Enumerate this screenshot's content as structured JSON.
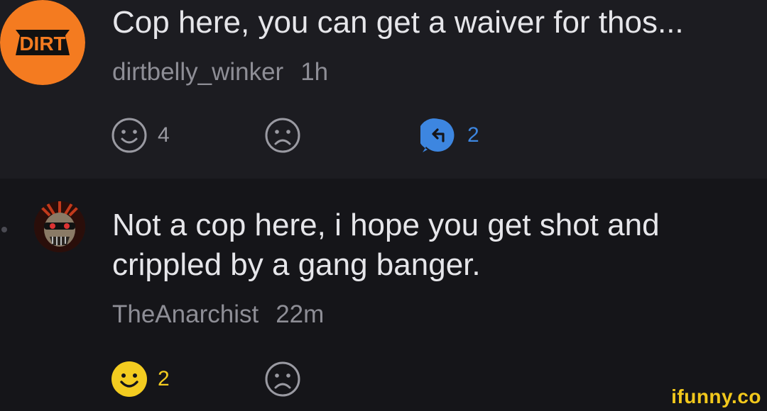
{
  "comments": [
    {
      "avatar": "dirt-logo-avatar",
      "avatar_text": "DIRT",
      "text": "Cop here, you can get a waiver for thos...",
      "username": "dirtbelly_winker",
      "time": "1h",
      "smile_count": "4",
      "reply_count": "2"
    },
    {
      "avatar": "skull-avatar",
      "text": "Not a cop here, i hope you get shot and crippled by a gang banger.",
      "username": "TheAnarchist",
      "time": "22m",
      "smile_count": "2"
    }
  ],
  "icons": {
    "smile": "smile-face-icon",
    "frown": "frown-face-icon",
    "reply": "reply-bubble-icon"
  },
  "colors": {
    "background": "#151519",
    "highlight_row": "#1c1c21",
    "text": "#e6e6ea",
    "muted": "#8e8e96",
    "reply_blue": "#3d86e0",
    "smile_yellow": "#f3cc20",
    "brand_orange": "#f47b20"
  },
  "watermark": "ifunny.co"
}
